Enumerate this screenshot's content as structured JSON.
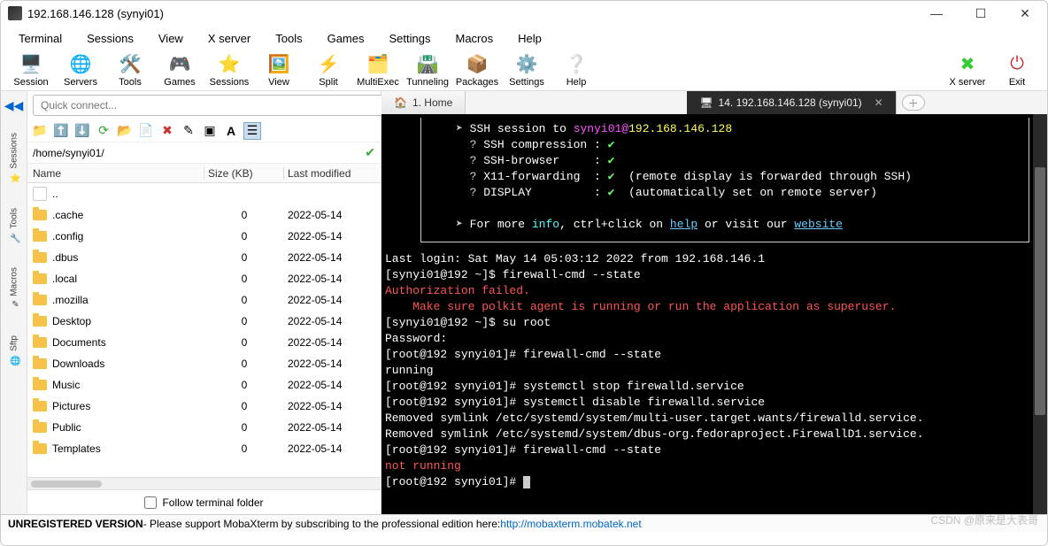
{
  "window": {
    "title": "192.168.146.128 (synyi01)"
  },
  "menu": {
    "items": [
      "Terminal",
      "Sessions",
      "View",
      "X server",
      "Tools",
      "Games",
      "Settings",
      "Macros",
      "Help"
    ]
  },
  "toolbar": {
    "items": [
      {
        "label": "Session",
        "icon": "🖥️"
      },
      {
        "label": "Servers",
        "icon": "🌐"
      },
      {
        "label": "Tools",
        "icon": "🛠️"
      },
      {
        "label": "Games",
        "icon": "🎮"
      },
      {
        "label": "Sessions",
        "icon": "⭐"
      },
      {
        "label": "View",
        "icon": "🖼️"
      },
      {
        "label": "Split",
        "icon": "⚡"
      },
      {
        "label": "MultiExec",
        "icon": "🗂️"
      },
      {
        "label": "Tunneling",
        "icon": "🛣️"
      },
      {
        "label": "Packages",
        "icon": "📦"
      },
      {
        "label": "Settings",
        "icon": "⚙️"
      },
      {
        "label": "Help",
        "icon": "❔"
      }
    ],
    "right": [
      {
        "label": "X server",
        "icon": "✖",
        "color": "#3c3"
      },
      {
        "label": "Exit",
        "icon": "⏻",
        "color": "#c33"
      }
    ]
  },
  "quick": {
    "placeholder": "Quick connect..."
  },
  "sidetabs": [
    "Sessions",
    "Tools",
    "Macros",
    "Sftp"
  ],
  "sftp": {
    "path": "/home/synyi01/",
    "columns": [
      "Name",
      "Size (KB)",
      "Last modified"
    ],
    "up": "..",
    "rows": [
      {
        "name": ".cache",
        "size": "0",
        "mod": "2022-05-14"
      },
      {
        "name": ".config",
        "size": "0",
        "mod": "2022-05-14"
      },
      {
        "name": ".dbus",
        "size": "0",
        "mod": "2022-05-14"
      },
      {
        "name": ".local",
        "size": "0",
        "mod": "2022-05-14"
      },
      {
        "name": ".mozilla",
        "size": "0",
        "mod": "2022-05-14"
      },
      {
        "name": "Desktop",
        "size": "0",
        "mod": "2022-05-14"
      },
      {
        "name": "Documents",
        "size": "0",
        "mod": "2022-05-14"
      },
      {
        "name": "Downloads",
        "size": "0",
        "mod": "2022-05-14"
      },
      {
        "name": "Music",
        "size": "0",
        "mod": "2022-05-14"
      },
      {
        "name": "Pictures",
        "size": "0",
        "mod": "2022-05-14"
      },
      {
        "name": "Public",
        "size": "0",
        "mod": "2022-05-14"
      },
      {
        "name": "Templates",
        "size": "0",
        "mod": "2022-05-14"
      }
    ],
    "follow": "Follow terminal folder"
  },
  "tabs": {
    "home": "1. Home",
    "active": "14. 192.168.146.128 (synyi01)"
  },
  "term": {
    "ssh_to_pre": "SSH session to ",
    "ssh_user": "synyi01",
    "ssh_at": "@",
    "ssh_host": "192.168.146.128",
    "comp": "SSH compression",
    "browser": "SSH-browser",
    "x11": "X11-forwarding",
    "x11_note": "(remote display is forwarded through SSH)",
    "display": "DISPLAY",
    "display_note": "(automatically set on remote server)",
    "more_pre": "For more ",
    "more_info": "info",
    "more_mid": ", ctrl+click on ",
    "more_help": "help",
    "more_mid2": " or visit our ",
    "more_site": "website",
    "lastlogin": "Last login: Sat May 14 05:03:12 2022 from 192.168.146.1",
    "p1": "[synyi01@192 ~]$ firewall-cmd --state",
    "auth1": "Authorization failed.",
    "auth2": "    Make sure polkit agent is running or run the application as superuser.",
    "p2": "[synyi01@192 ~]$ su root",
    "pw": "Password:",
    "p3": "[root@192 synyi01]# firewall-cmd --state",
    "run": "running",
    "p4": "[root@192 synyi01]# systemctl stop firewalld.service",
    "p5": "[root@192 synyi01]# systemctl disable firewalld.service",
    "rm1": "Removed symlink /etc/systemd/system/multi-user.target.wants/firewalld.service.",
    "rm2": "Removed symlink /etc/systemd/system/dbus-org.fedoraproject.FirewallD1.service.",
    "p6": "[root@192 synyi01]# firewall-cmd --state",
    "notrun": "not running",
    "p7": "[root@192 synyi01]# "
  },
  "status": {
    "unreg": "UNREGISTERED VERSION",
    "mid": "  -   Please support MobaXterm by subscribing to the professional edition here:  ",
    "url": "http://mobaxterm.mobatek.net"
  },
  "watermark": "CSDN @原来是大表哥"
}
